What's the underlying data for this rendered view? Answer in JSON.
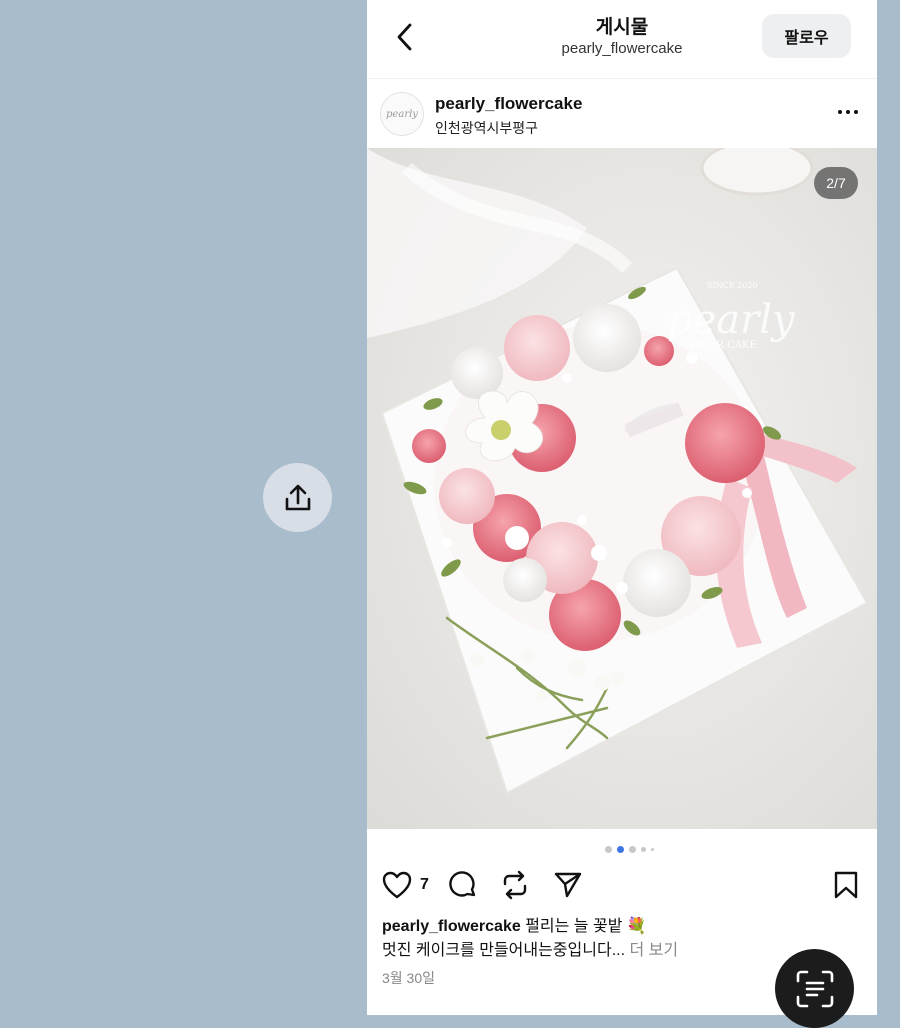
{
  "header": {
    "title": "게시물",
    "subtitle": "pearly_flowercake",
    "follow_label": "팔로우"
  },
  "post": {
    "username": "pearly_flowercake",
    "location": "인천광역시부평구",
    "avatar_text": "pearly",
    "image_counter": "2/7",
    "watermark_small": "SINCE 2020",
    "watermark_brand": "pearly",
    "watermark_sub": "FLOWER CAKE",
    "like_count": "7",
    "caption_user": "pearly_flowercake",
    "caption_line1": "펄리는 늘 꽃밭 💐",
    "caption_line2": "멋진 케이크를 만들어내는중입니다...",
    "more_label": "더 보기",
    "date": "3월 30일",
    "carousel_active_index": 1,
    "carousel_visible_dots": 5
  },
  "icons": {
    "back": "chevron-left-icon",
    "more": "more-horizontal-icon",
    "like": "heart-icon",
    "comment": "comment-icon",
    "repost": "repost-icon",
    "send": "send-icon",
    "save": "bookmark-icon",
    "share": "share-icon",
    "scan": "scan-text-icon"
  },
  "colors": {
    "background": "#a9bccc",
    "accent": "#3f74e4"
  }
}
